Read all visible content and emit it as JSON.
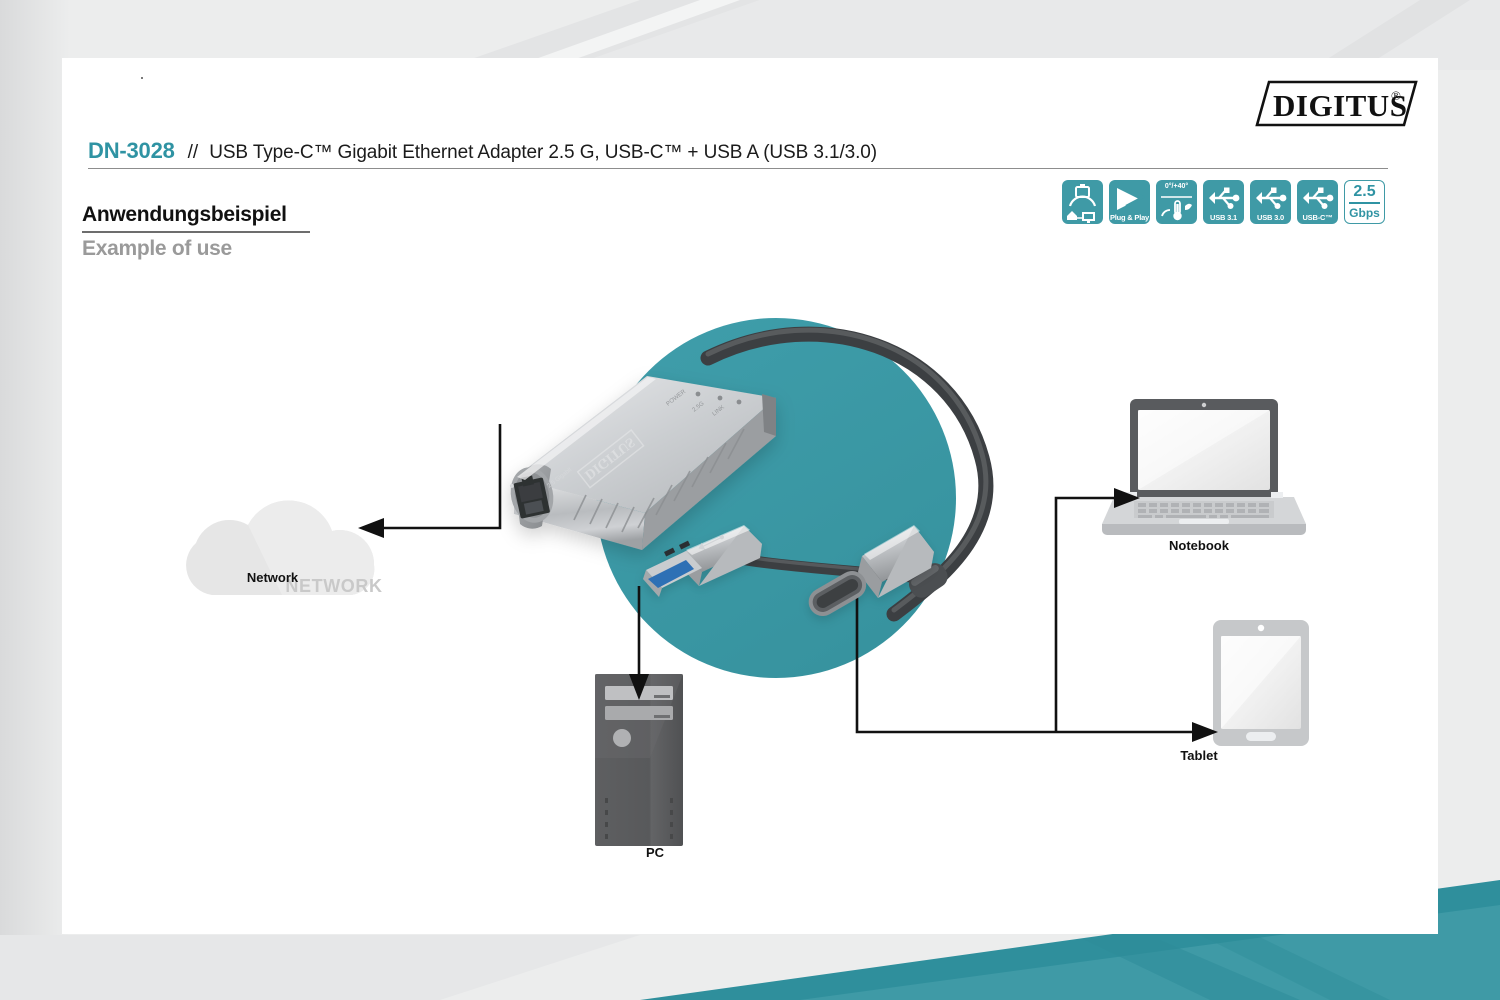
{
  "document": {
    "sku": "DN-3028",
    "separator": "//",
    "title": "USB Type-C™ Gigabit Ethernet Adapter 2.5 G, USB-C™ + USB A (USB 3.1/3.0)",
    "brand_logo_text": "DIGITUS",
    "brand_logo_mark": "®"
  },
  "headings": {
    "german": "Anwendungsbeispiel",
    "english": "Example of use"
  },
  "badges": [
    {
      "id": "home-office-icon",
      "label": "",
      "type": "icon"
    },
    {
      "id": "plug-and-play-icon",
      "label": "Plug & Play",
      "type": "icon-label"
    },
    {
      "id": "temperature-range-icon",
      "label": "",
      "top_label": "0°/+40°",
      "type": "icon-temp"
    },
    {
      "id": "usb-icon",
      "label": "USB 3.1",
      "type": "icon-label"
    },
    {
      "id": "usb-icon",
      "label": "USB 3.0",
      "type": "icon-label"
    },
    {
      "id": "usb-icon",
      "label": "USB-C™",
      "type": "icon-label"
    },
    {
      "id": "speed-badge",
      "label": "Gbps",
      "value": "2.5",
      "type": "speed"
    }
  ],
  "diagram": {
    "cloud_text": "NETWORK",
    "devices": [
      {
        "name": "network",
        "label": "Network"
      },
      {
        "name": "pc",
        "label": "PC"
      },
      {
        "name": "notebook",
        "label": "Notebook"
      },
      {
        "name": "tablet",
        "label": "Tablet"
      }
    ],
    "product": {
      "name": "usb-c-gigabit-ethernet-adapter",
      "housing_logo": "DIGITUS",
      "port": "RJ45",
      "connectors": [
        "USB-A",
        "USB-C"
      ]
    }
  },
  "colors": {
    "teal": "#3f9aa6",
    "teal_circle": "#3b9ba8",
    "teal_wedge": "#2f8f9c",
    "sku_teal": "#2f93a3",
    "page_bg": "#eceded",
    "card_bg": "#ffffff",
    "heading_gray": "#9a9a9a",
    "cloud_gray": "#e4e4e4",
    "device_gray": "#58595b",
    "arrow_black": "#111111"
  }
}
